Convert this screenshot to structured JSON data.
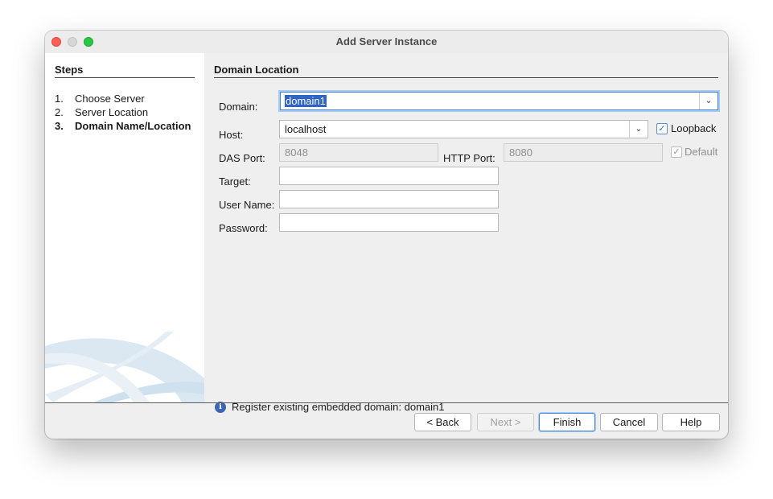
{
  "window": {
    "title": "Add Server Instance"
  },
  "steps": {
    "heading": "Steps",
    "items": [
      {
        "num": "1.",
        "label": "Choose Server"
      },
      {
        "num": "2.",
        "label": "Server Location"
      },
      {
        "num": "3.",
        "label": "Domain Name/Location"
      }
    ],
    "current_index": 2
  },
  "panel": {
    "heading": "Domain Location",
    "domain": {
      "label": "Domain:",
      "value": "domain1"
    },
    "host": {
      "label": "Host:",
      "value": "localhost"
    },
    "loopback": {
      "label": "Loopback",
      "checked": true
    },
    "das_port": {
      "label": "DAS Port:",
      "value": "8048"
    },
    "http_port": {
      "label": "HTTP Port:",
      "value": "8080"
    },
    "default": {
      "label": "Default",
      "checked": true
    },
    "target": {
      "label": "Target:",
      "value": ""
    },
    "user_name": {
      "label": "User Name:",
      "value": ""
    },
    "password": {
      "label": "Password:",
      "value": ""
    },
    "info_message": "Register existing embedded domain: domain1"
  },
  "buttons": {
    "back": "< Back",
    "next": "Next >",
    "finish": "Finish",
    "cancel": "Cancel",
    "help": "Help"
  },
  "icons": {
    "info": "info-icon",
    "dropdown": "chevron-down-icon",
    "check": "checkmark-icon"
  },
  "colors": {
    "selection": "#2e64c5",
    "focus_ring": "#a9c9ef",
    "close": "#ff5f57",
    "maximize": "#28c840"
  }
}
